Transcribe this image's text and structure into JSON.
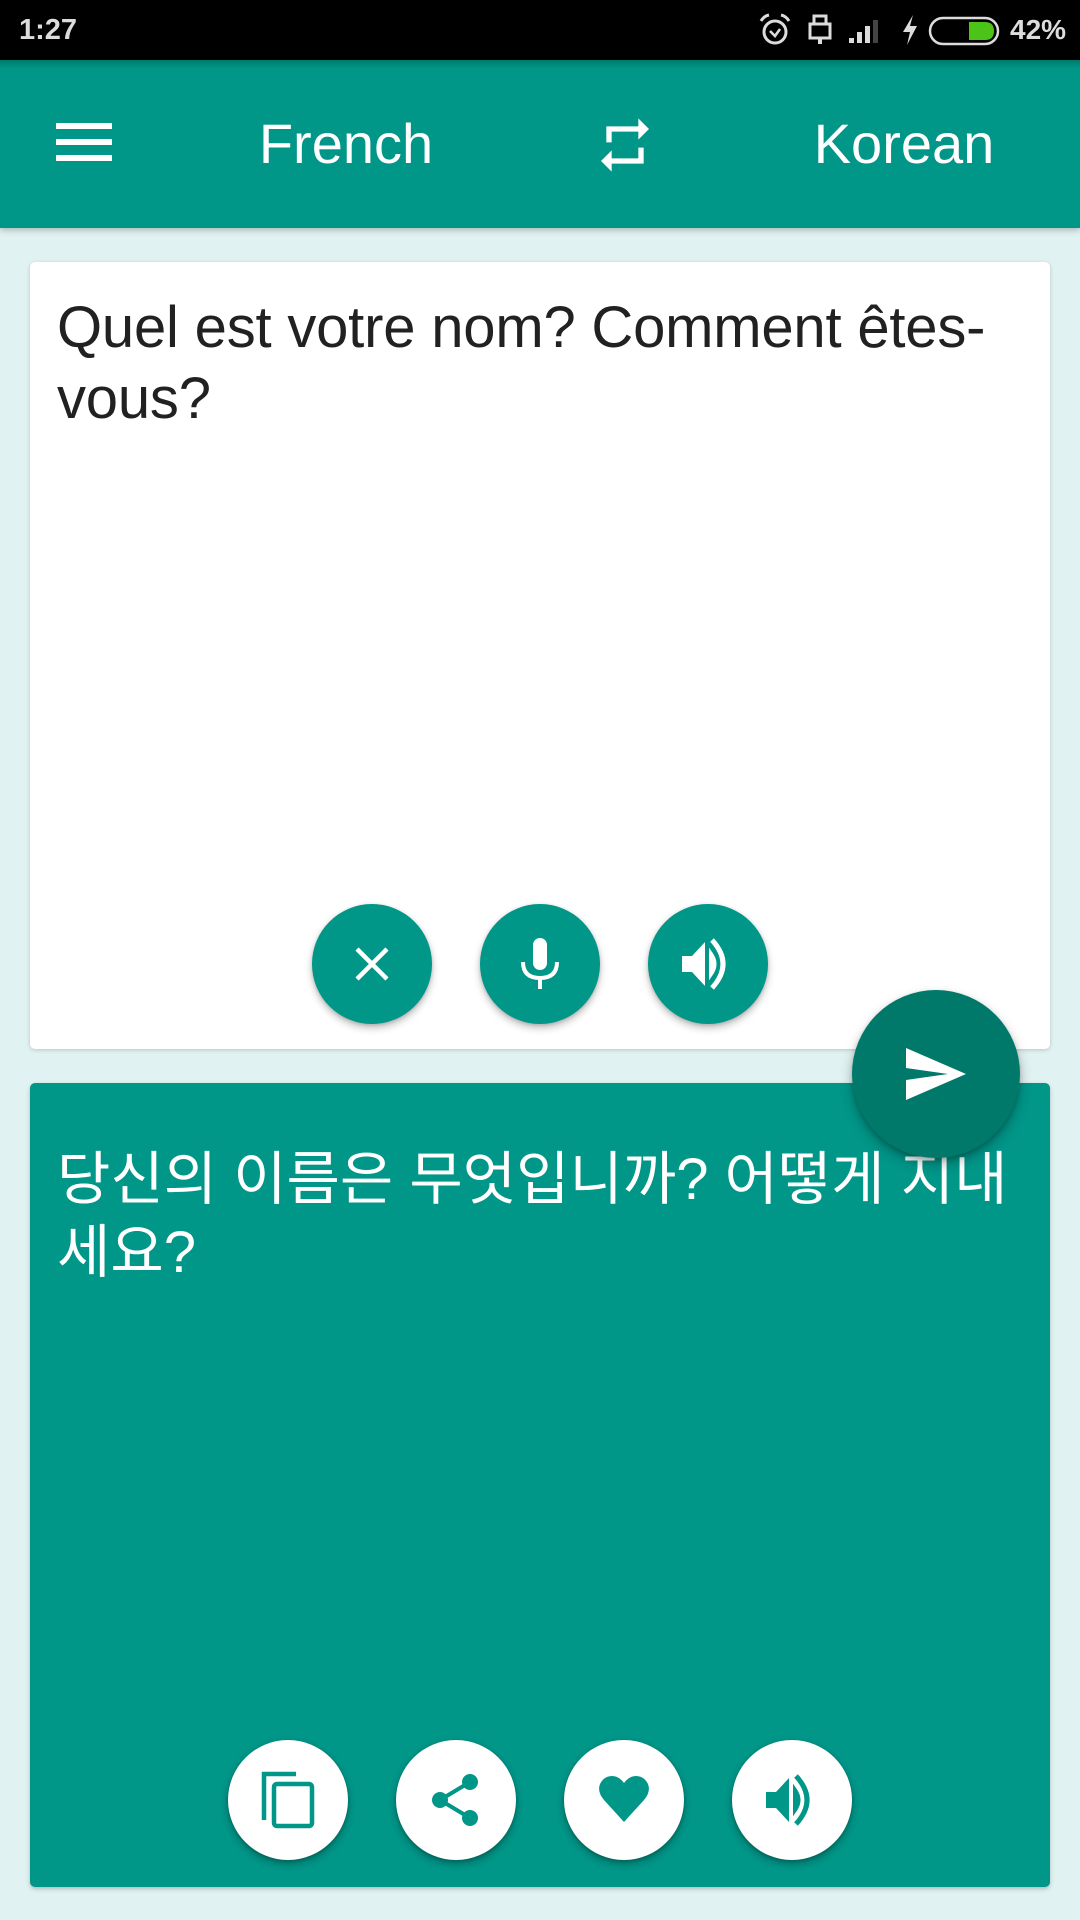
{
  "status_bar": {
    "time": "1:27",
    "icons": [
      "alarm-icon",
      "usb-lock-icon",
      "signal-icon",
      "charging-icon",
      "battery-icon"
    ],
    "battery_percent": "42%",
    "battery_level": 0.42,
    "battery_color": "#4CC417"
  },
  "app_bar": {
    "menu_icon": "hamburger-menu-icon",
    "source_language": "French",
    "swap_icon": "swap-languages-icon",
    "target_language": "Korean",
    "color": "#009688"
  },
  "input": {
    "segments": [
      {
        "text": "Quel",
        "misspelled": true
      },
      {
        "text": " est ",
        "misspelled": false
      },
      {
        "text": "votre",
        "misspelled": true
      },
      {
        "text": " ",
        "misspelled": false
      },
      {
        "text": "nom",
        "misspelled": true
      },
      {
        "text": "? Comment ",
        "misspelled": false
      },
      {
        "text": "êtes-",
        "misspelled": true
      },
      {
        "text": "vous",
        "misspelled": true
      },
      {
        "text": "?",
        "misspelled": false
      }
    ],
    "full_text": "Quel est votre nom? Comment êtes-vous?",
    "actions": [
      {
        "name": "clear",
        "icon": "close-icon"
      },
      {
        "name": "voice-input",
        "icon": "microphone-icon"
      },
      {
        "name": "speak-source",
        "icon": "speaker-icon"
      }
    ]
  },
  "translate_button": {
    "icon": "send-icon",
    "color": "#00796B"
  },
  "output": {
    "text": "당신의 이름은 무엇입니까? 어떻게 지내세요?",
    "actions": [
      {
        "name": "copy",
        "icon": "copy-icon"
      },
      {
        "name": "share",
        "icon": "share-icon"
      },
      {
        "name": "favorite",
        "icon": "heart-icon"
      },
      {
        "name": "speak-translation",
        "icon": "speaker-icon"
      }
    ]
  },
  "colors": {
    "background": "#E0F2F1",
    "accent": "#009688",
    "spellcheck_underline": "#F44848"
  }
}
